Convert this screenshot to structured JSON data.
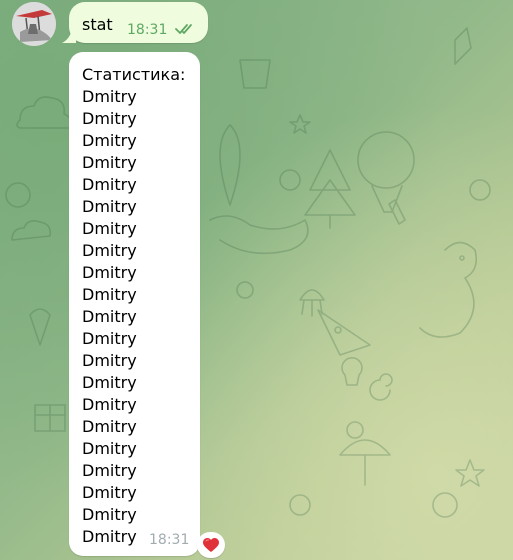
{
  "chat": {
    "outgoing": {
      "text": "stat",
      "time": "18:31",
      "status_icon": "double-check-icon"
    },
    "incoming": {
      "header": "Статистика:",
      "lines": [
        "Dmitry",
        "Dmitry",
        "Dmitry",
        "Dmitry",
        "Dmitry",
        "Dmitry",
        "Dmitry",
        "Dmitry",
        "Dmitry",
        "Dmitry",
        "Dmitry",
        "Dmitry",
        "Dmitry",
        "Dmitry",
        "Dmitry",
        "Dmitry",
        "Dmitry",
        "Dmitry",
        "Dmitry",
        "Dmitry",
        "Dmitry"
      ],
      "time": "18:31",
      "reaction": "❤️"
    }
  },
  "colors": {
    "outgoing_bubble": "#effdde",
    "incoming_bubble": "#ffffff",
    "read_check": "#5fa864",
    "heart": "#e0303a"
  }
}
